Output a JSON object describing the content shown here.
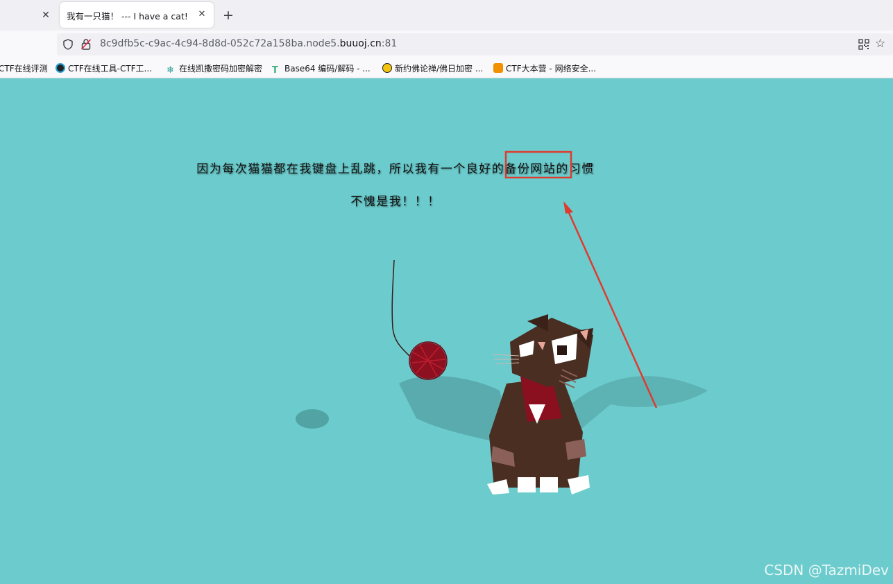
{
  "browser": {
    "active_tab_title": "我有一只猫！ --- I have a cat!",
    "prev_tab_close": "✕",
    "tab_close": "✕",
    "new_tab": "+",
    "url": {
      "host_prefix": "8c9dfb5c-c9ac-4c94-8d8d-052c72a158ba.node5.",
      "domain": "buuoj.cn",
      "port": ":81"
    },
    "bookmarks": [
      {
        "label": "CTF在线评测",
        "icon": "none"
      },
      {
        "label": "CTF在线工具-CTF工...",
        "icon": "ctf-tools-icon"
      },
      {
        "label": "在线凯撒密码加密解密",
        "icon": "gear-icon"
      },
      {
        "label": "Base64 编码/解码 - ...",
        "icon": "t-icon"
      },
      {
        "label": "新约佛论禅/佛日加密 ...",
        "icon": "emoji-icon"
      },
      {
        "label": "CTF大本营 - 网络安全...",
        "icon": "hexagon-icon"
      }
    ]
  },
  "page": {
    "line1": "因为每次猫猫都在我键盘上乱跳，所以我有一个良好的备份网站的习惯",
    "line2": "不愧是我！！！",
    "colors": {
      "background": "#6ccbcc",
      "highlight": "#e03a2f"
    }
  },
  "watermark": "CSDN @TazmiDev"
}
